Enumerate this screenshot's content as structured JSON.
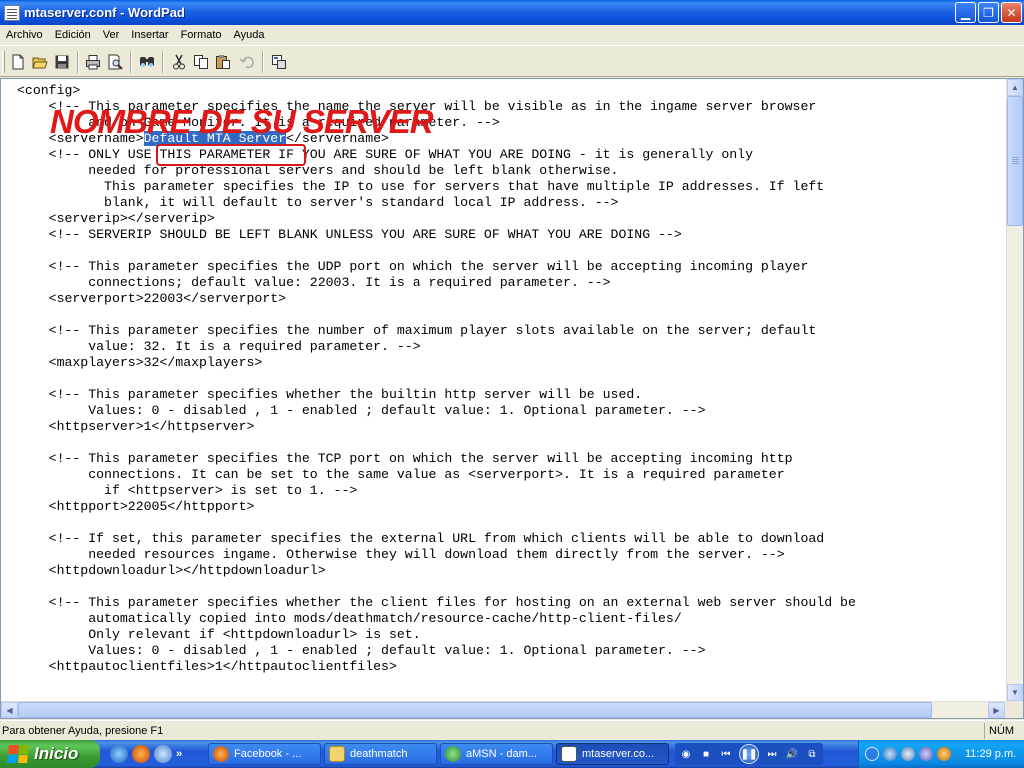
{
  "window": {
    "title": "mtaserver.conf - WordPad"
  },
  "menu": {
    "items": [
      "Archivo",
      "Edición",
      "Ver",
      "Insertar",
      "Formato",
      "Ayuda"
    ]
  },
  "toolbar": {
    "icons": [
      "new-icon",
      "open-icon",
      "save-icon",
      "print-icon",
      "print-preview-icon",
      "find-icon",
      "cut-icon",
      "copy-icon",
      "paste-icon",
      "undo-icon",
      "insert-object-icon"
    ]
  },
  "document": {
    "line1": "<config>",
    "line2_pre": "    <!-- This parameter specifies the name the server will be visible as in the ingame server browser",
    "line3": "         and on Game-Monitor. It is a required parameter. -->",
    "servername_open": "    <servername>",
    "servername_value": "Default MTA Server",
    "servername_close": "</servername>",
    "rest": "\n    <!-- ONLY USE THIS PARAMETER IF YOU ARE SURE OF WHAT YOU ARE DOING - it is generally only\n         needed for professional servers and should be left blank otherwise.\n           This parameter specifies the IP to use for servers that have multiple IP addresses. If left\n           blank, it will default to server's standard local IP address. -->\n    <serverip></serverip>\n    <!-- SERVERIP SHOULD BE LEFT BLANK UNLESS YOU ARE SURE OF WHAT YOU ARE DOING -->\n\n    <!-- This parameter specifies the UDP port on which the server will be accepting incoming player\n         connections; default value: 22003. It is a required parameter. -->\n    <serverport>22003</serverport>\n\n    <!-- This parameter specifies the number of maximum player slots available on the server; default\n         value: 32. It is a required parameter. -->\n    <maxplayers>32</maxplayers>\n\n    <!-- This parameter specifies whether the builtin http server will be used.\n         Values: 0 - disabled , 1 - enabled ; default value: 1. Optional parameter. -->\n    <httpserver>1</httpserver>\n\n    <!-- This parameter specifies the TCP port on which the server will be accepting incoming http\n         connections. It can be set to the same value as <serverport>. It is a required parameter\n           if <httpserver> is set to 1. -->\n    <httpport>22005</httpport>\n\n    <!-- If set, this parameter specifies the external URL from which clients will be able to download\n         needed resources ingame. Otherwise they will download them directly from the server. -->\n    <httpdownloadurl></httpdownloadurl>\n\n    <!-- This parameter specifies whether the client files for hosting on an external web server should be\n         automatically copied into mods/deathmatch/resource-cache/http-client-files/\n         Only relevant if <httpdownloadurl> is set.\n         Values: 0 - disabled , 1 - enabled ; default value: 1. Optional parameter. -->\n    <httpautoclientfiles>1</httpautoclientfiles>"
  },
  "overlay": {
    "annotation": "NOMBRE DE SU SERVER"
  },
  "status": {
    "message": "Para obtener Ayuda, presione F1",
    "num": "NÚM"
  },
  "taskbar": {
    "start_label": "Inicio",
    "tasks": [
      "Facebook - ...",
      "deathmatch",
      "aMSN - dam...",
      "mtaserver.co..."
    ],
    "quick_more": "»",
    "clock": "11:29 p.m."
  },
  "colors": {
    "selection": "#316ac5",
    "annotation_red": "#e01818",
    "titlebar_blue": "#0a4fd8"
  }
}
